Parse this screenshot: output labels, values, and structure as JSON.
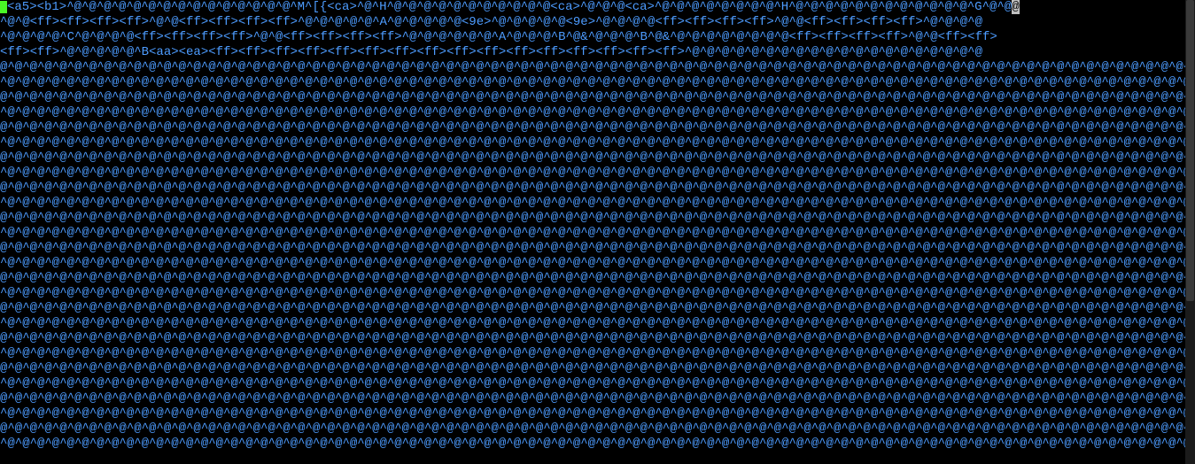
{
  "terminal": {
    "cursor": true,
    "highlight": {
      "line": 0,
      "col": 135,
      "text": "@"
    },
    "lines": [
      "<a5><b1>^@^@^@^@^@^@^@^@^@^@^@^@^@^@^@^M^[{<ca>^@^H^@^@^@^@^@^@^@^@^@^@^@<ca>^@^@^@<ca>^@^@^@^@^@^@^@^@^H^@^@^@^@^@^@^@^@^@^@^@^@^G^@^@",
      "^@^@<ff><ff><ff><ff>^@^@<ff><ff><ff><ff>^@^@^@^@^@^A^@^@^@^@^@<9e>^@^@^@^@^@<9e>^@^@^@^@<ff><ff><ff><ff>^@^@<ff><ff><ff><ff>^@^@^@^@",
      "^@^@^@^@^C^@^@^@^@<ff><ff><ff><ff>^@^@<ff><ff><ff><ff>^@^@^@^@^@^@^A^@^@^@^B^@&^@^@^@^B^@&^@^@^@^@^@^@^@^@<ff><ff><ff><ff>^@^@<ff><ff>",
      "<ff><ff>^@^@^@^@^@^B<aa><ea><ff><ff><ff><ff><ff><ff><ff><ff><ff><ff><ff><ff><ff><ff><ff><ff>^@^@^@^@^@^@^@^@^@^@^@^@^@^@^@^@^@^@^@^@",
      "@^@^@^@^@^@^@^@^@^@^@^@^@^@^@^@^@^@^@^@^@^@^@^@^@^@^@^@^@^@^@^@^@^@^@^@^@^@^@^@^@^@^@^@^@^@^@^@^@^@^@^@^@^@^@^@^@^@^@^@^@^@^@^@^@^@^@^@^@^@^@^@^@^@^@^@^@^@^@^@^@^@^@^@",
      "^@^@^@^@^@^@^@^@^@^@^@^@^@^@^@^@^@^@^@^@^@^@^@^@^@^@^@^@^@^@^@^@^@^@^@^@^@^@^@^@^@^@^@^@^@^@^@^@^@^@^@^@^@^@^@^@^@^@^@^@^@^@^@^@^@^@^@^@^@^@^@^@^@^@^@^@^@^@^@^@^@^@^@^",
      "@^@^@^@^@^@^@^@^@^@^@^@^@^@^@^@^@^@^@^@^@^@^@^@^@^@^@^@^@^@^@^@^@^@^@^@^@^@^@^@^@^@^@^@^@^@^@^@^@^@^@^@^@^@^@^@^@^@^@^@^@^@^@^@^@^@^@^@^@^@^@^@^@^@^@^@^@^@^@^@^@^@^@^@",
      "^@^@^@^@^@^@^@^@^@^@^@^@^@^@^@^@^@^@^@^@^@^@^@^@^@^@^@^@^@^@^@^@^@^@^@^@^@^@^@^@^@^@^@^@^@^@^@^@^@^@^@^@^@^@^@^@^@^@^@^@^@^@^@^@^@^@^@^@^@^@^@^@^@^@^@^@^@^@^@^@^@^@^@^",
      "@^@^@^@^@^@^@^@^@^@^@^@^@^@^@^@^@^@^@^@^@^@^@^@^@^@^@^@^@^@^@^@^@^@^@^@^@^@^@^@^@^@^@^@^@^@^@^@^@^@^@^@^@^@^@^@^@^@^@^@^@^@^@^@^@^@^@^@^@^@^@^@^@^@^@^@^@^@^@^@^@^@^@^@",
      "^@^@^@^@^@^@^@^@^@^@^@^@^@^@^@^@^@^@^@^@^@^@^@^@^@^@^@^@^@^@^@^@^@^@^@^@^@^@^@^@^@^@^@^@^@^@^@^@^@^@^@^@^@^@^@^@^@^@^@^@^@^@^@^@^@^@^@^@^@^@^@^@^@^@^@^@^@^@^@^@^@^@^@^",
      "@^@^@^@^@^@^@^@^@^@^@^@^@^@^@^@^@^@^@^@^@^@^@^@^@^@^@^@^@^@^@^@^@^@^@^@^@^@^@^@^@^@^@^@^@^@^@^@^@^@^@^@^@^@^@^@^@^@^@^@^@^@^@^@^@^@^@^@^@^@^@^@^@^@^@^@^@^@^@^@^@^@^@^@",
      "^@^@^@^@^@^@^@^@^@^@^@^@^@^@^@^@^@^@^@^@^@^@^@^@^@^@^@^@^@^@^@^@^@^@^@^@^@^@^@^@^@^@^@^@^@^@^@^@^@^@^@^@^@^@^@^@^@^@^@^@^@^@^@^@^@^@^@^@^@^@^@^@^@^@^@^@^@^@^@^@^@^@^@^",
      "@^@^@^@^@^@^@^@^@^@^@^@^@^@^@^@^@^@^@^@^@^@^@^@^@^@^@^@^@^@^@^@^@^@^@^@^@^@^@^@^@^@^@^@^@^@^@^@^@^@^@^@^@^@^@^@^@^@^@^@^@^@^@^@^@^@^@^@^@^@^@^@^@^@^@^@^@^@^@^@^@^@^@^@",
      "^@^@^@^@^@^@^@^@^@^@^@^@^@^@^@^@^@^@^@^@^@^@^@^@^@^@^@^@^@^@^@^@^@^@^@^@^@^@^@^@^@^@^@^@^@^@^@^@^@^@^@^@^@^@^@^@^@^@^@^@^@^@^@^@^@^@^@^@^@^@^@^@^@^@^@^@^@^@^@^@^@^@^@^",
      "@^@^@^@^@^@^@^@^@^@^@^@^@^@^@^@^@^@^@^@^@^@^@^@^@^@^@^@^@^@^@^@^@^@^@^@^@^@^@^@^@^@^@^@^@^@^@^@^@^@^@^@^@^@^@^@^@^@^@^@^@^@^@^@^@^@^@^@^@^@^@^@^@^@^@^@^@^@^@^@^@^@^@^@",
      "^@^@^@^@^@^@^@^@^@^@^@^@^@^@^@^@^@^@^@^@^@^@^@^@^@^@^@^@^@^@^@^@^@^@^@^@^@^@^@^@^@^@^@^@^@^@^@^@^@^@^@^@^@^@^@^@^@^@^@^@^@^@^@^@^@^@^@^@^@^@^@^@^@^@^@^@^@^@^@^@^@^@^@^",
      "@^@^@^@^@^@^@^@^@^@^@^@^@^@^@^@^@^@^@^@^@^@^@^@^@^@^@^@^@^@^@^@^@^@^@^@^@^@^@^@^@^@^@^@^@^@^@^@^@^@^@^@^@^@^@^@^@^@^@^@^@^@^@^@^@^@^@^@^@^@^@^@^@^@^@^@^@^@^@^@^@^@^@^@",
      "^@^@^@^@^@^@^@^@^@^@^@^@^@^@^@^@^@^@^@^@^@^@^@^@^@^@^@^@^@^@^@^@^@^@^@^@^@^@^@^@^@^@^@^@^@^@^@^@^@^@^@^@^@^@^@^@^@^@^@^@^@^@^@^@^@^@^@^@^@^@^@^@^@^@^@^@^@^@^@^@^@^@^@^",
      "@^@^@^@^@^@^@^@^@^@^@^@^@^@^@^@^@^@^@^@^@^@^@^@^@^@^@^@^@^@^@^@^@^@^@^@^@^@^@^@^@^@^@^@^@^@^@^@^@^@^@^@^@^@^@^@^@^@^@^@^@^@^@^@^@^@^@^@^@^@^@^@^@^@^@^@^@^@^@^@^@^@^@^@",
      "^@^@^@^@^@^@^@^@^@^@^@^@^@^@^@^@^@^@^@^@^@^@^@^@^@^@^@^@^@^@^@^@^@^@^@^@^@^@^@^@^@^@^@^@^@^@^@^@^@^@^@^@^@^@^@^@^@^@^@^@^@^@^@^@^@^@^@^@^@^@^@^@^@^@^@^@^@^@^@^@^@^@^@^",
      "@^@^@^@^@^@^@^@^@^@^@^@^@^@^@^@^@^@^@^@^@^@^@^@^@^@^@^@^@^@^@^@^@^@^@^@^@^@^@^@^@^@^@^@^@^@^@^@^@^@^@^@^@^@^@^@^@^@^@^@^@^@^@^@^@^@^@^@^@^@^@^@^@^@^@^@^@^@^@^@^@^@^@^@",
      "^@^@^@^@^@^@^@^@^@^@^@^@^@^@^@^@^@^@^@^@^@^@^@^@^@^@^@^@^@^@^@^@^@^@^@^@^@^@^@^@^@^@^@^@^@^@^@^@^@^@^@^@^@^@^@^@^@^@^@^@^@^@^@^@^@^@^@^@^@^@^@^@^@^@^@^@^@^@^@^@^@^@^@^",
      "@^@^@^@^@^@^@^@^@^@^@^@^@^@^@^@^@^@^@^@^@^@^@^@^@^@^@^@^@^@^@^@^@^@^@^@^@^@^@^@^@^@^@^@^@^@^@^@^@^@^@^@^@^@^@^@^@^@^@^@^@^@^@^@^@^@^@^@^@^@^@^@^@^@^@^@^@^@^@^@^@^@^@^@",
      "^@^@^@^@^@^@^@^@^@^@^@^@^@^@^@^@^@^@^@^@^@^@^@^@^@^@^@^@^@^@^@^@^@^@^@^@^@^@^@^@^@^@^@^@^@^@^@^@^@^@^@^@^@^@^@^@^@^@^@^@^@^@^@^@^@^@^@^@^@^@^@^@^@^@^@^@^@^@^@^@^@^@^@^",
      "@^@^@^@^@^@^@^@^@^@^@^@^@^@^@^@^@^@^@^@^@^@^@^@^@^@^@^@^@^@^@^@^@^@^@^@^@^@^@^@^@^@^@^@^@^@^@^@^@^@^@^@^@^@^@^@^@^@^@^@^@^@^@^@^@^@^@^@^@^@^@^@^@^@^@^@^@^@^@^@^@^@^@^@",
      "^@^@^@^@^@^@^@^@^@^@^@^@^@^@^@^@^@^@^@^@^@^@^@^@^@^@^@^@^@^@^@^@^@^@^@^@^@^@^@^@^@^@^@^@^@^@^@^@^@^@^@^@^@^@^@^@^@^@^@^@^@^@^@^@^@^@^@^@^@^@^@^@^@^@^@^@^@^@^@^@^@^@^@^",
      "@^@^@^@^@^@^@^@^@^@^@^@^@^@^@^@^@^@^@^@^@^@^@^@^@^@^@^@^@^@^@^@^@^@^@^@^@^@^@^@^@^@^@^@^@^@^@^@^@^@^@^@^@^@^@^@^@^@^@^@^@^@^@^@^@^@^@^@^@^@^@^@^@^@^@^@^@^@^@^@^@^@^@^@",
      "^@^@^@^@^@^@^@^@^@^@^@^@^@^@^@^@^@^@^@^@^@^@^@^@^@^@^@^@^@^@^@^@^@^@^@^@^@^@^@^@^@^@^@^@^@^@^@^@^@^@^@^@^@^@^@^@^@^@^@^@^@^@^@^@^@^@^@^@^@^@^@^@^@^@^@^@^@^@^@^@^@^@^@^",
      "@^@^@^@^@^@^@^@^@^@^@^@^@^@^@^@^@^@^@^@^@^@^@^@^@^@^@^@^@^@^@^@^@^@^@^@^@^@^@^@^@^@^@^@^@^@^@^@^@^@^@^@^@^@^@^@^@^@^@^@^@^@^@^@^@^@^@^@^@^@^@^@^@^@^@^@^@^@^@^@^@^@^@^@",
      "^@^@^@^@^@^@^@^@^@^@^@^@^@^@^@^@^@^@^@^@^@^@^@^@^@^@^@^@^@^@^@^@^@^@^@^@^@^@^@^@^@^@^@^@^@^@^@^@^@^@^@^@^@^@^@^@^@^@^@^@^@^@^@^@^@^@^@^@^@^@^@^@^@^@^@^@^@^@^@^@^@^@^@^"
    ]
  }
}
